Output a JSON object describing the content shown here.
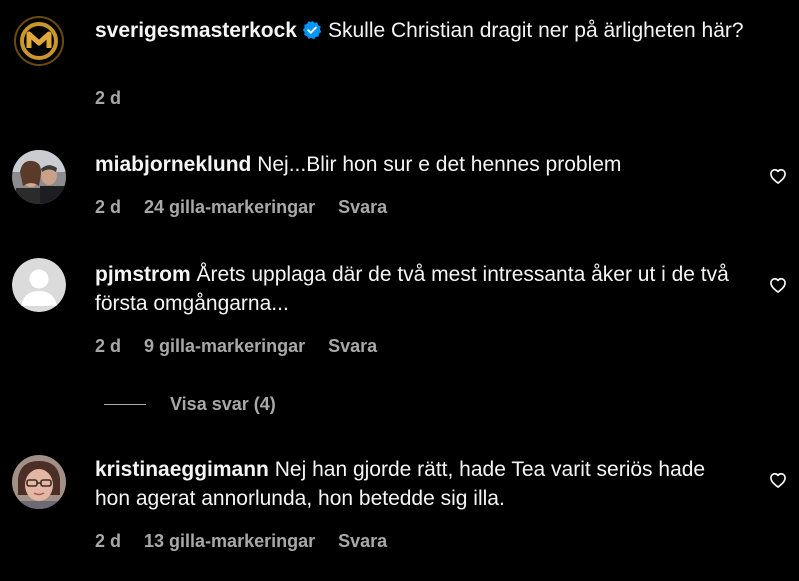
{
  "post": {
    "username": "sverigesmasterkock",
    "caption": "Skulle Christian dragit ner på ärligheten här?",
    "time": "2 d"
  },
  "comments": [
    {
      "username": "miabjorneklund",
      "text": "Nej...Blir hon sur e det hennes problem",
      "time": "2 d",
      "likes": "24 gilla-markeringar",
      "reply": "Svara"
    },
    {
      "username": "pjmstrom",
      "text": "Årets upplaga där de två mest intressanta åker ut i de två första omgångarna...",
      "time": "2 d",
      "likes": "9 gilla-markeringar",
      "reply": "Svara",
      "view_replies": "Visa svar (4)"
    },
    {
      "username": "kristinaeggimann",
      "text": "Nej han gjorde rätt, hade Tea varit seriös hade hon agerat annorlunda, hon betedde sig illa.",
      "time": "2 d",
      "likes": "13 gilla-markeringar",
      "reply": "Svara"
    }
  ],
  "icons": {
    "verified": "verified-badge-icon",
    "like": "heart-outline-icon"
  },
  "colors": {
    "background": "#000000",
    "text": "#f5f5f5",
    "secondary": "#a8a8a8",
    "verified": "#0095f6",
    "logo_gold": "#c8962a"
  }
}
